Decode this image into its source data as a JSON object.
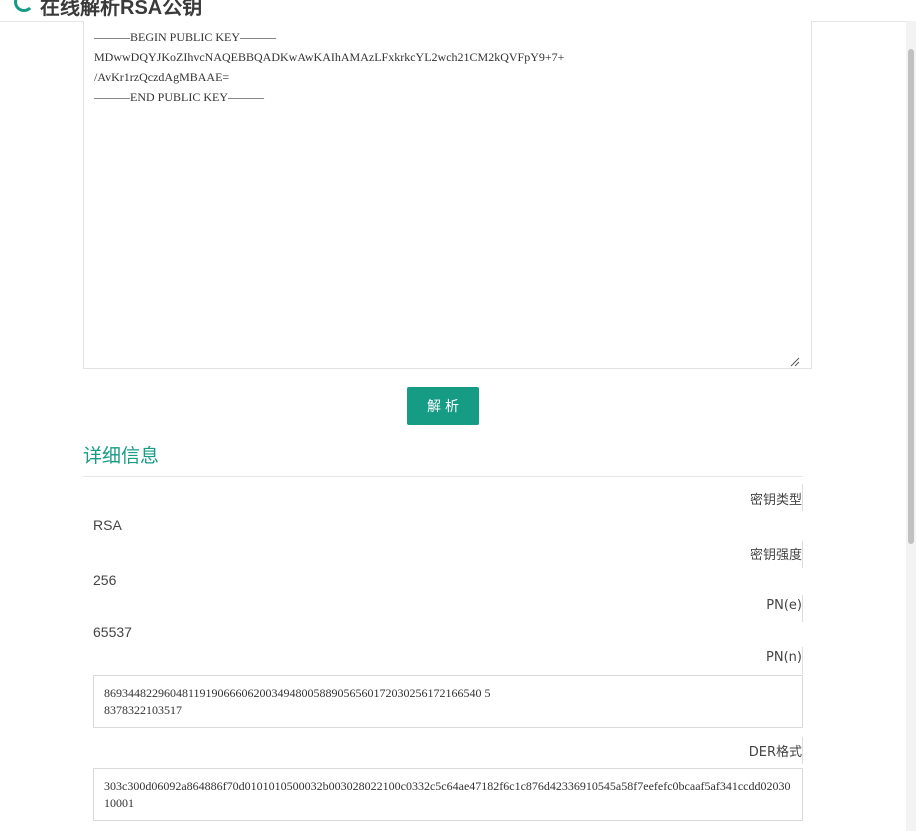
{
  "header": {
    "title": "在线解析RSA公钥"
  },
  "key_input": {
    "value": "———BEGIN PUBLIC KEY———\nMDwwDQYJKoZIhvcNAQEBBQADKwAwKAIhAMAzLFxkrkcYL2wch21CM2kQVFpY9+7+\n/AvKr1rzQczdAgMBAAE=\n———END PUBLIC KEY———"
  },
  "parse_button": {
    "label": "解析"
  },
  "details": {
    "title": "详细信息",
    "key_type": {
      "label": "密钥类型",
      "value": "RSA"
    },
    "key_strength": {
      "label": "密钥强度",
      "value": "256"
    },
    "pn_e": {
      "label": "PN(e)",
      "value": "65537"
    },
    "pn_n": {
      "label": "PN(n)",
      "value": "869344822960481191906660620034948005889056560172030256172166540 5\n8378322103517"
    },
    "der": {
      "label": "DER格式",
      "value": "303c300d06092a864886f70d0101010500032b003028022100c0332c5c64ae47182f6c1c876d42336910545a58f7eefefc0bcaaf5af341ccdd0203010001"
    }
  },
  "colors": {
    "accent": "#169b85"
  }
}
